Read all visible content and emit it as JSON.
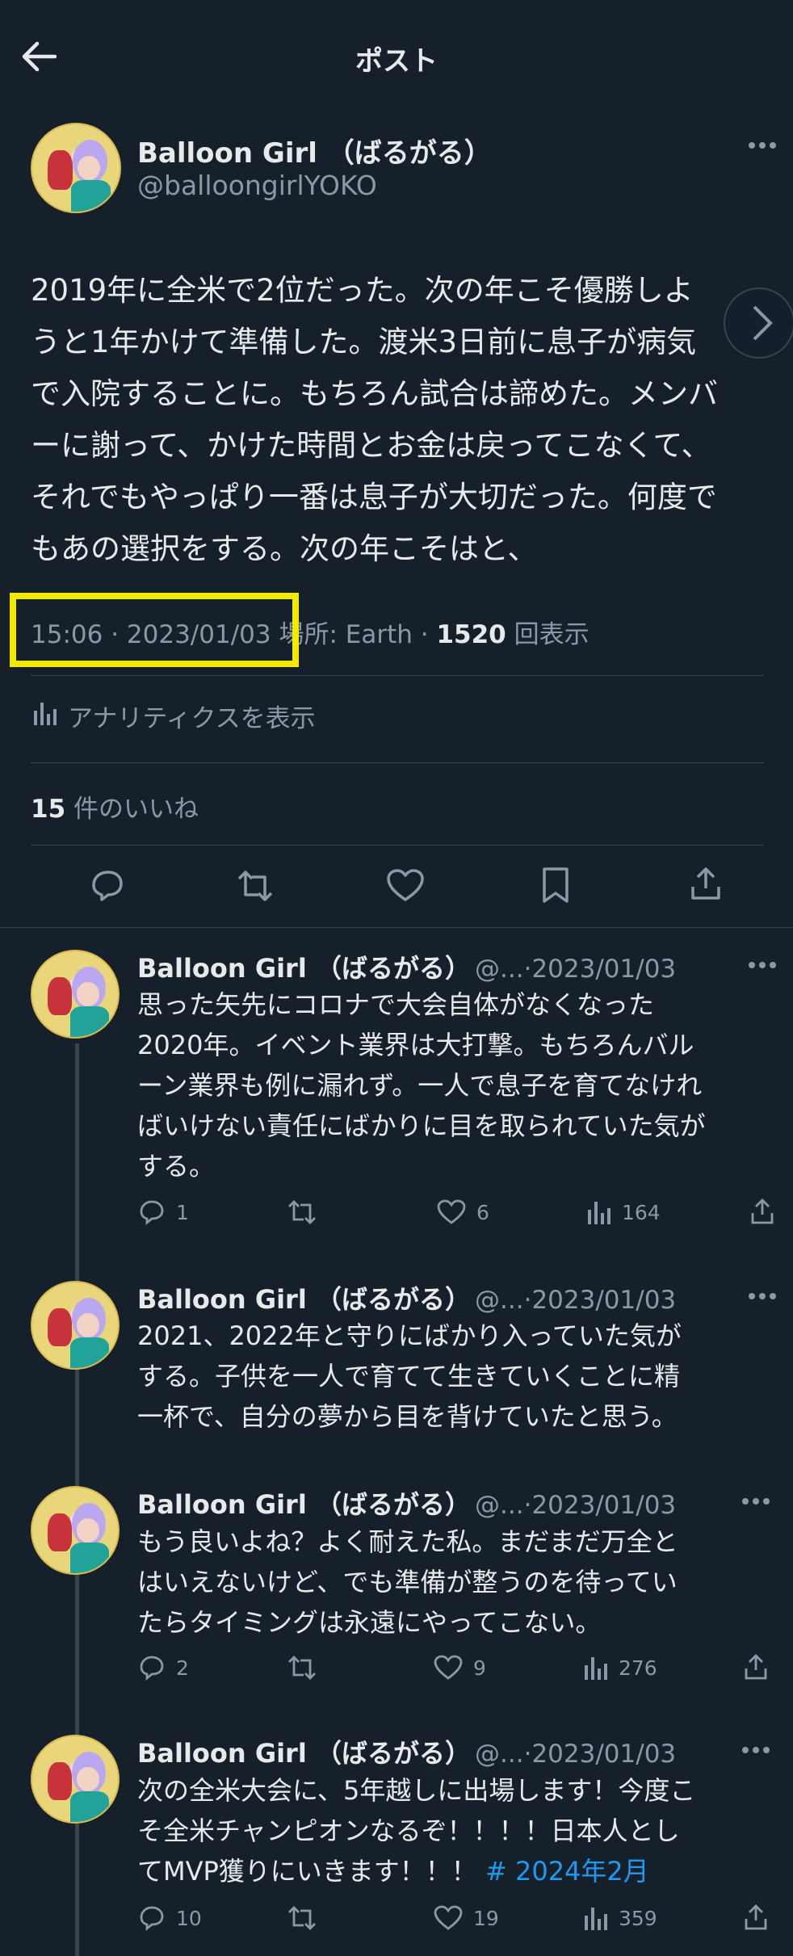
{
  "header": {
    "title": "ポスト"
  },
  "post": {
    "display_name": "Balloon Girl （ばるがる）",
    "handle": "@balloongirlYOKO",
    "lines": [
      "2019年に全米で2位だった。次の年こそ優勝しよ",
      "うと1年かけて準備した。渡米3日前に息子が病気",
      "で入院することに。もちろん試合は諦めた。メンバ",
      "ーに謝って、かけた時間とお金は戻ってこなくて、",
      "それでもやっぱり一番は息子が大切だった。何度で",
      "もあの選択をする。次の年こそはと、"
    ],
    "time": "15:06",
    "date": "2023/01/03",
    "location": "場所: Earth",
    "views_count": "1520",
    "views_label": "回表示",
    "analytics": "アナリティクスを表示",
    "likes_count": "15",
    "likes_label": "件のいいね"
  },
  "replies": [
    {
      "name": "Balloon Girl （ばるがる）",
      "handle_date": "@...·2023/01/03",
      "lines": [
        "思った矢先にコロナで大会自体がなくなった",
        "2020年。イベント業界は大打撃。もちろんバル",
        "ーン業界も例に漏れず。一人で息子を育てなけれ",
        "ばいけない責任にばかりに目を取られていた気が",
        "する。"
      ],
      "replies": "1",
      "likes": "6",
      "views": "164"
    },
    {
      "name": "Balloon Girl （ばるがる）",
      "handle_date": "@...·2023/01/03",
      "lines": [
        "2021、2022年と守りにばかり入っていた気が",
        "する。子供を一人で育てて生きていくことに精",
        "一杯で、自分の夢から目を背けていたと思う。"
      ]
    },
    {
      "name": "Balloon Girl （ばるがる）",
      "handle_date": "@...·2023/01/03",
      "lines": [
        "もう良いよね？よく耐えた私。まだまだ万全と",
        "はいえないけど、でも準備が整うのを待ってい",
        "たらタイミングは永遠にやってこない。"
      ],
      "replies": "2",
      "likes": "9",
      "views": "276"
    },
    {
      "name": "Balloon Girl （ばるがる）",
      "handle_date": "@...·2023/01/03",
      "lines": [
        "次の全米大会に、5年越しに出場します！今度こ",
        "そ全米チャンピオンなるぞ！！！！日本人とし",
        "てMVP獲りにいきます！！！"
      ],
      "hashtag": "# 2024年2月",
      "replies": "10",
      "likes": "19",
      "views": "359"
    }
  ],
  "colors": {
    "background": "#15202b",
    "text": "#e7e9ea",
    "muted": "#8b98a5",
    "link": "#1d9bf0",
    "highlight": "#f4ea00"
  }
}
